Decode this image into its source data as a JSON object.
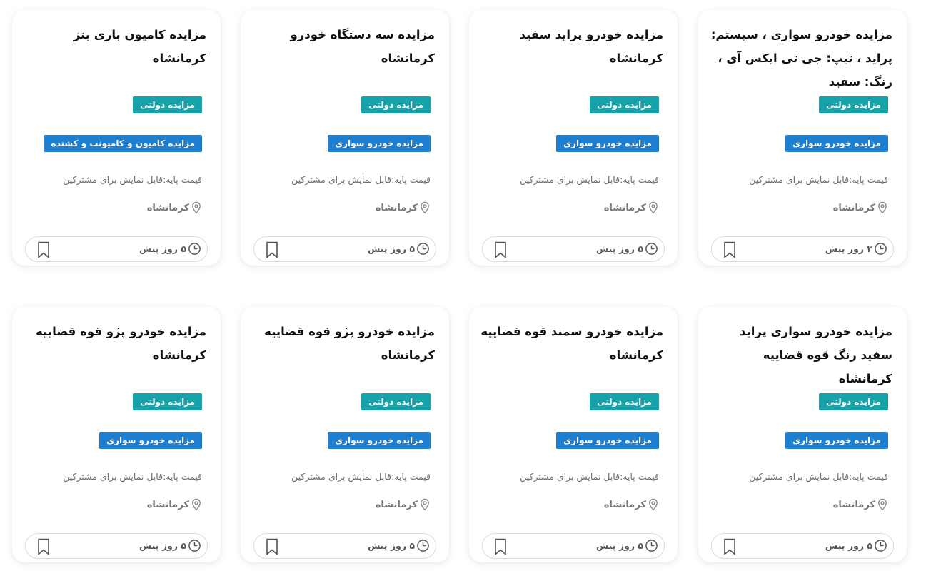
{
  "cards": [
    {
      "title": "مزایده خودرو سواری ، سیستم: پراید ، تیپ: جی تی ایکس آی ، رنگ: سفید",
      "tag_gov": "مزایده دولتی",
      "tag_cat": "مزایده خودرو سواری",
      "price": "قیمت پایه:قابل نمایش برای مشترکین",
      "location": "کرمانشاه",
      "time": "۳ روز پیش",
      "bookmark_icon": "bookmark-icon"
    },
    {
      "title": "مزایده خودرو پراید سفید کرمانشاه",
      "tag_gov": "مزایده دولتی",
      "tag_cat": "مزایده خودرو سواری",
      "price": "قیمت پایه:قابل نمایش برای مشترکین",
      "location": "کرمانشاه",
      "time": "۵ روز پیش",
      "bookmark_icon": "bookmark-icon"
    },
    {
      "title": "مزایده سه دستگاه خودرو کرمانشاه",
      "tag_gov": "مزایده دولتی",
      "tag_cat": "مزایده خودرو سواری",
      "price": "قیمت پایه:قابل نمایش برای مشترکین",
      "location": "کرمانشاه",
      "time": "۵ روز پیش",
      "bookmark_icon": "bookmark-icon"
    },
    {
      "title": "مزایده کامیون باری بنز کرمانشاه",
      "tag_gov": "مزایده دولتی",
      "tag_cat": "مزایده کامیون و کامیونت و کشنده",
      "price": "قیمت پایه:قابل نمایش برای مشترکین",
      "location": "کرمانشاه",
      "time": "۵ روز پیش",
      "bookmark_icon": "bookmark-icon"
    },
    {
      "title": "مزایده خودرو سواری پراید سفید رنگ قوه قضاییه کرمانشاه",
      "tag_gov": "مزایده دولتی",
      "tag_cat": "مزایده خودرو سواری",
      "price": "قیمت پایه:قابل نمایش برای مشترکین",
      "location": "کرمانشاه",
      "time": "۵ روز پیش",
      "bookmark_icon": "bookmark-icon"
    },
    {
      "title": "مزایده خودرو سمند قوه قضاییه کرمانشاه",
      "tag_gov": "مزایده دولتی",
      "tag_cat": "مزایده خودرو سواری",
      "price": "قیمت پایه:قابل نمایش برای مشترکین",
      "location": "کرمانشاه",
      "time": "۵ روز پیش",
      "bookmark_icon": "bookmark-icon"
    },
    {
      "title": "مزایده خودرو پژو قوه قضاییه کرمانشاه",
      "tag_gov": "مزایده دولتی",
      "tag_cat": "مزایده خودرو سواری",
      "price": "قیمت پایه:قابل نمایش برای مشترکین",
      "location": "کرمانشاه",
      "time": "۵ روز پیش",
      "bookmark_icon": "bookmark-icon"
    },
    {
      "title": "مزایده خودرو پژو قوه قضاییه کرمانشاه",
      "tag_gov": "مزایده دولتی",
      "tag_cat": "مزایده خودرو سواری",
      "price": "قیمت پایه:قابل نمایش برای مشترکین",
      "location": "کرمانشاه",
      "time": "۵ روز پیش",
      "bookmark_icon": "bookmark-icon"
    }
  ],
  "colors": {
    "tag_gov": "#17a2a8",
    "tag_cat": "#1e7fd1"
  }
}
